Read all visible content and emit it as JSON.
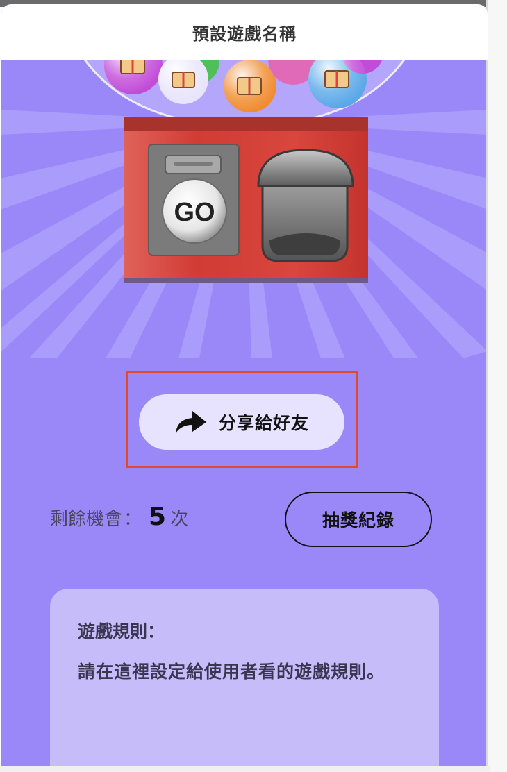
{
  "header": {
    "title": "預設遊戲名稱"
  },
  "machine": {
    "go_label": "GO"
  },
  "share": {
    "label": "分享給好友",
    "icon": "share-arrow-icon"
  },
  "chances": {
    "label": "剩餘機會",
    "colon": "：",
    "count": "5",
    "unit": "次"
  },
  "record": {
    "label": "抽獎紀錄"
  },
  "rules": {
    "title": "遊戲規則：",
    "text": "請在這裡設定給使用者看的遊戲規則。"
  },
  "colors": {
    "background": "#9b88f8",
    "header": "#ffffff",
    "share_button": "#e7e3ff",
    "highlight_border": "#e04a2a",
    "rules_card": "#c6bcfa",
    "machine_body": "#d8463e"
  }
}
